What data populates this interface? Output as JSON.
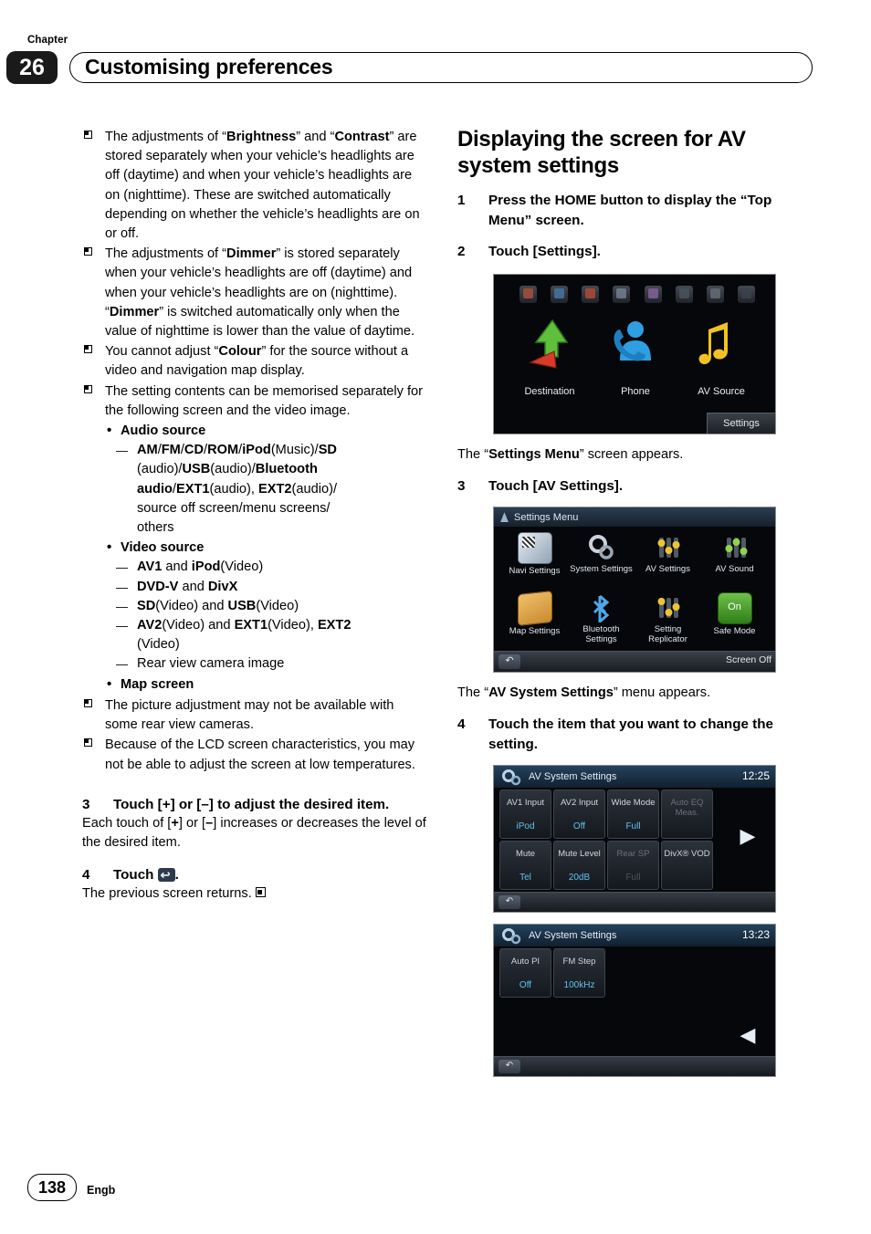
{
  "header": {
    "chapter_word": "Chapter",
    "chapter_number": "26",
    "title": "Customising preferences"
  },
  "left_column": {
    "notes": [
      {
        "id": "note1",
        "html": "The adjustments of “<b>Brightness</b>” and “<b>Contrast</b>” are stored separately when your vehicle’s headlights are off (daytime) and when your vehicle’s headlights are on (nighttime). These are switched automatically depending on whether the vehicle’s headlights are on or off."
      },
      {
        "id": "note2",
        "html": "The adjustments of “<b>Dimmer</b>” is stored separately when your vehicle’s headlights are off (daytime) and when your vehicle’s headlights are on (nighttime). “<b>Dimmer</b>” is switched automatically only when the value of nighttime is lower than the value of daytime."
      },
      {
        "id": "note3",
        "html": "You cannot adjust “<b>Colour</b>” for the source without a video and navigation map display."
      },
      {
        "id": "note4",
        "html": "The setting contents can be memorised separately for the following screen and the video image."
      }
    ],
    "sublists": [
      {
        "title": "Audio source",
        "entries": [
          "<b>AM</b>/<b>FM</b>/<b>CD</b>/<b>ROM</b>/<b>iPod</b>(Music)/<b>SD</b>",
          "(audio)/<b>USB</b>(audio)/<b>Bluetooth</b>",
          "<b>audio</b>/<b>EXT1</b>(audio), <b>EXT2</b>(audio)/",
          "source off screen/menu screens/",
          "others"
        ]
      },
      {
        "title": "Video source",
        "entries": [
          "<b>AV1</b> and <b>iPod</b>(Video)",
          "<b>DVD-V</b> and <b>DivX</b>",
          "<b>SD</b>(Video) and <b>USB</b>(Video)",
          "<b>AV2</b>(Video) and <b>EXT1</b>(Video), <b>EXT2</b>",
          "(Video)",
          "Rear view camera image"
        ]
      },
      {
        "title": "Map screen",
        "entries": []
      }
    ],
    "notes_after": [
      {
        "id": "note5",
        "html": "The picture adjustment may not be available with some rear view cameras."
      },
      {
        "id": "note6",
        "html": "Because of the LCD screen characteristics, you may not be able to adjust the screen at low temperatures."
      }
    ],
    "step3": {
      "number": "3",
      "text_html": "Touch [<b>+</b>] or [<b>–</b>] to adjust the desired item.",
      "body_html": "Each touch of [<b>+</b>] or [<b>–</b>] increases or decreases the level of the desired item."
    },
    "step4": {
      "number": "4",
      "label": "Touch",
      "icon": "back-arrow-icon",
      "body": "The previous screen returns.",
      "end_mark": "end-of-note-icon"
    }
  },
  "right_column": {
    "heading": "Displaying the screen for AV system settings",
    "steps": [
      {
        "number": "1",
        "text": "Press the HOME button to display the “Top Menu” screen."
      },
      {
        "number": "2",
        "text": "Touch [Settings]."
      },
      {
        "number": "3",
        "text": "Touch [AV Settings]."
      },
      {
        "number": "4",
        "text": "Touch the item that you want to change the setting."
      }
    ],
    "caption_after_2_html": "The “<b>Settings Menu</b>” screen appears.",
    "caption_after_3_html": "The “<b>AV System Settings</b>” menu appears.",
    "top_menu_screen": {
      "items": [
        {
          "label": "Destination",
          "icon": "destination-arrow-icon"
        },
        {
          "label": "Phone",
          "icon": "phone-person-icon"
        },
        {
          "label": "AV Source",
          "icon": "music-note-icon"
        }
      ],
      "settings_button": "Settings"
    },
    "settings_menu_screen": {
      "title": "Settings Menu",
      "tiles": [
        {
          "label": "Navi Settings",
          "icon": "navi-settings-icon"
        },
        {
          "label": "System Settings",
          "icon": "system-settings-icon"
        },
        {
          "label": "AV Settings",
          "icon": "av-settings-icon"
        },
        {
          "label": "AV Sound",
          "icon": "av-sound-icon"
        },
        {
          "label": "Map Settings",
          "icon": "map-settings-icon"
        },
        {
          "label": "Bluetooth Settings",
          "icon": "bluetooth-settings-icon"
        },
        {
          "label": "Setting Replicator",
          "icon": "setting-replicator-icon"
        },
        {
          "label": "Safe Mode",
          "icon": "safe-mode-icon"
        }
      ],
      "back_icon": "back-arrow-icon",
      "screen_off": "Screen Off"
    },
    "av_system_settings_screen_1": {
      "title": "AV System Settings",
      "clock": "12:25",
      "buttons": [
        {
          "label": "AV1 Input",
          "value": "iPod",
          "dim": false
        },
        {
          "label": "AV2 Input",
          "value": "Off",
          "dim": false
        },
        {
          "label": "Wide Mode",
          "value": "Full",
          "dim": false
        },
        {
          "label": "Auto EQ Meas.",
          "value": "",
          "dim": true
        },
        {
          "label": "Mute",
          "value": "Tel",
          "dim": false
        },
        {
          "label": "Mute Level",
          "value": "20dB",
          "dim": false
        },
        {
          "label": "Rear SP",
          "value": "Full",
          "dim": true
        },
        {
          "label": "DivX® VOD",
          "value": "",
          "dim": false
        }
      ],
      "next_arrow": "▶",
      "back_icon": "back-arrow-icon"
    },
    "av_system_settings_screen_2": {
      "title": "AV System Settings",
      "clock": "13:23",
      "buttons": [
        {
          "label": "Auto PI",
          "value": "Off",
          "dim": false
        },
        {
          "label": "FM Step",
          "value": "100kHz",
          "dim": false
        }
      ],
      "prev_arrow": "◀",
      "back_icon": "back-arrow-icon"
    }
  },
  "footer": {
    "page_number": "138",
    "language": "Engb"
  }
}
